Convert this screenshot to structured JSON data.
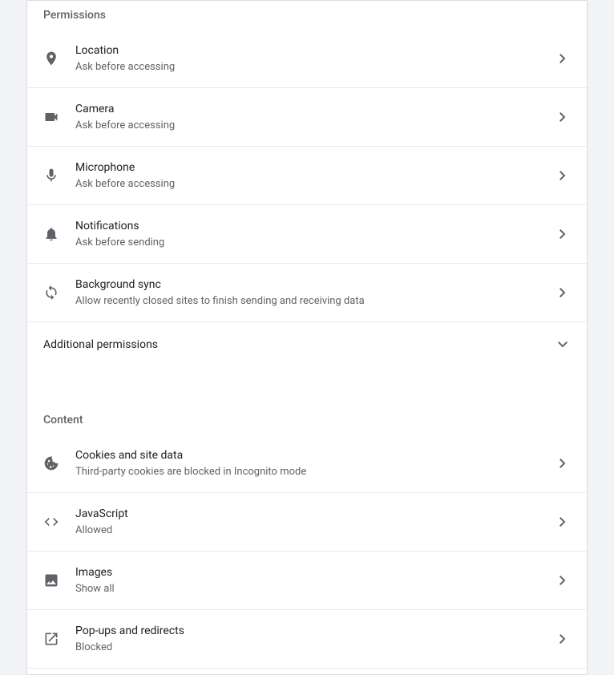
{
  "sections": {
    "permissions": {
      "header": "Permissions",
      "items": {
        "location": {
          "title": "Location",
          "subtitle": "Ask before accessing"
        },
        "camera": {
          "title": "Camera",
          "subtitle": "Ask before accessing"
        },
        "microphone": {
          "title": "Microphone",
          "subtitle": "Ask before accessing"
        },
        "notifications": {
          "title": "Notifications",
          "subtitle": "Ask before sending"
        },
        "background_sync": {
          "title": "Background sync",
          "subtitle": "Allow recently closed sites to finish sending and receiving data"
        }
      },
      "additional": "Additional permissions"
    },
    "content": {
      "header": "Content",
      "items": {
        "cookies": {
          "title": "Cookies and site data",
          "subtitle": "Third-party cookies are blocked in Incognito mode"
        },
        "javascript": {
          "title": "JavaScript",
          "subtitle": "Allowed"
        },
        "images": {
          "title": "Images",
          "subtitle": "Show all"
        },
        "popups": {
          "title": "Pop-ups and redirects",
          "subtitle": "Blocked"
        }
      }
    }
  }
}
